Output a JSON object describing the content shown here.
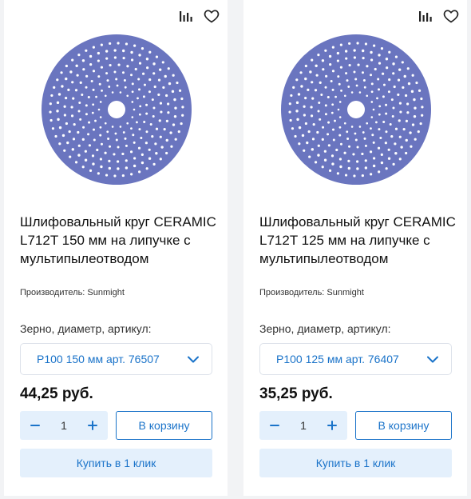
{
  "colors": {
    "accent": "#1a73c9",
    "light_accent": "#e4f0fc",
    "disc": "#6a75bf"
  },
  "products": [
    {
      "title": "Шлифовальный круг CERAMIC L712T 150 мм на липучке с мультипылеотводом",
      "manufacturer": "Производитель: Sunmight",
      "option_label": "Зерно, диаметр, артикул:",
      "option_value": "P100 150 мм арт. 76507",
      "price": "44,25 руб.",
      "quantity": "1",
      "cart_label": "В корзину",
      "one_click_label": "Купить в 1 клик",
      "icons": [
        "compare-icon",
        "favorite-heart-icon",
        "chevron-down-icon",
        "minus-icon",
        "plus-icon"
      ]
    },
    {
      "title": "Шлифовальный круг CERAMIC L712T 125 мм на липучке с мультипылеотводом",
      "manufacturer": "Производитель: Sunmight",
      "option_label": "Зерно, диаметр, артикул:",
      "option_value": "P100 125 мм арт. 76407",
      "price": "35,25 руб.",
      "quantity": "1",
      "cart_label": "В корзину",
      "one_click_label": "Купить в 1 клик",
      "icons": [
        "compare-icon",
        "favorite-heart-icon",
        "chevron-down-icon",
        "minus-icon",
        "plus-icon"
      ]
    }
  ]
}
